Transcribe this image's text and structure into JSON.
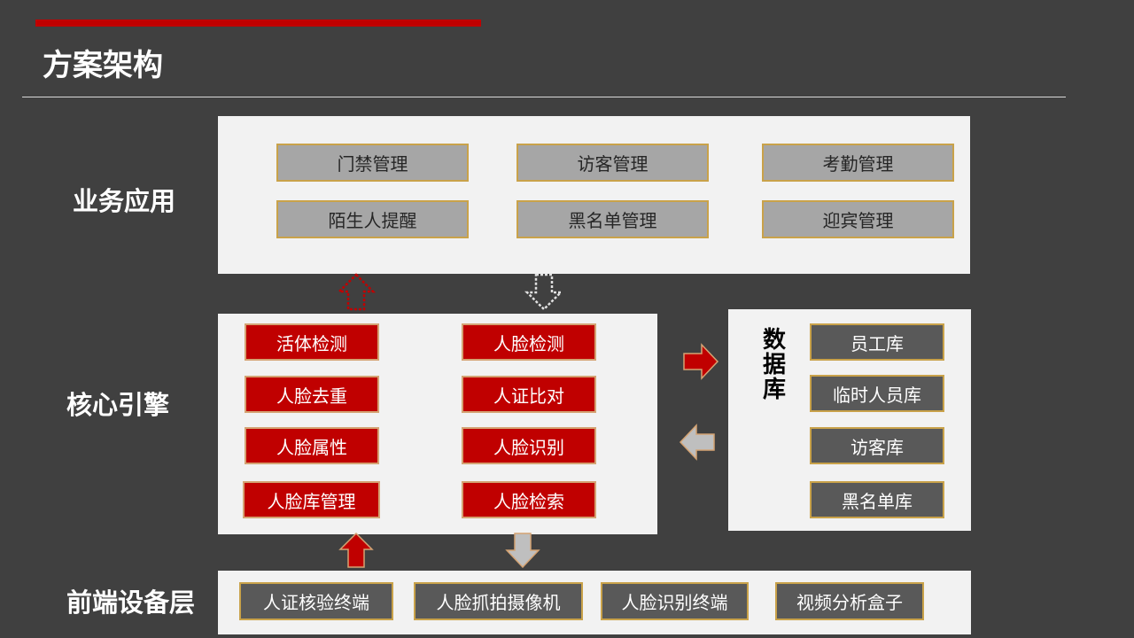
{
  "title": "方案架构",
  "layers": {
    "business": "业务应用",
    "core": "核心引擎",
    "frontend": "前端设备层"
  },
  "business_apps": [
    "门禁管理",
    "访客管理",
    "考勤管理",
    "陌生人提醒",
    "黑名单管理",
    "迎宾管理"
  ],
  "core_engine": [
    "活体检测",
    "人脸检测",
    "人脸去重",
    "人证比对",
    "人脸属性",
    "人脸识别",
    "人脸库管理",
    "人脸检索"
  ],
  "database": {
    "title": "数据库",
    "items": [
      "员工库",
      "临时人员库",
      "访客库",
      "黑名单库"
    ]
  },
  "frontend_devices": [
    "人证核验终端",
    "人脸抓拍摄像机",
    "人脸识别终端",
    "视频分析盒子"
  ],
  "colors": {
    "background": "#404040",
    "accent_red": "#c00000",
    "panel": "#f2f2f2",
    "app_box": "#a6a6a6",
    "dark_box": "#595959",
    "gold_border": "#c9a24a",
    "gray_arrow": "#bfbfbf"
  }
}
